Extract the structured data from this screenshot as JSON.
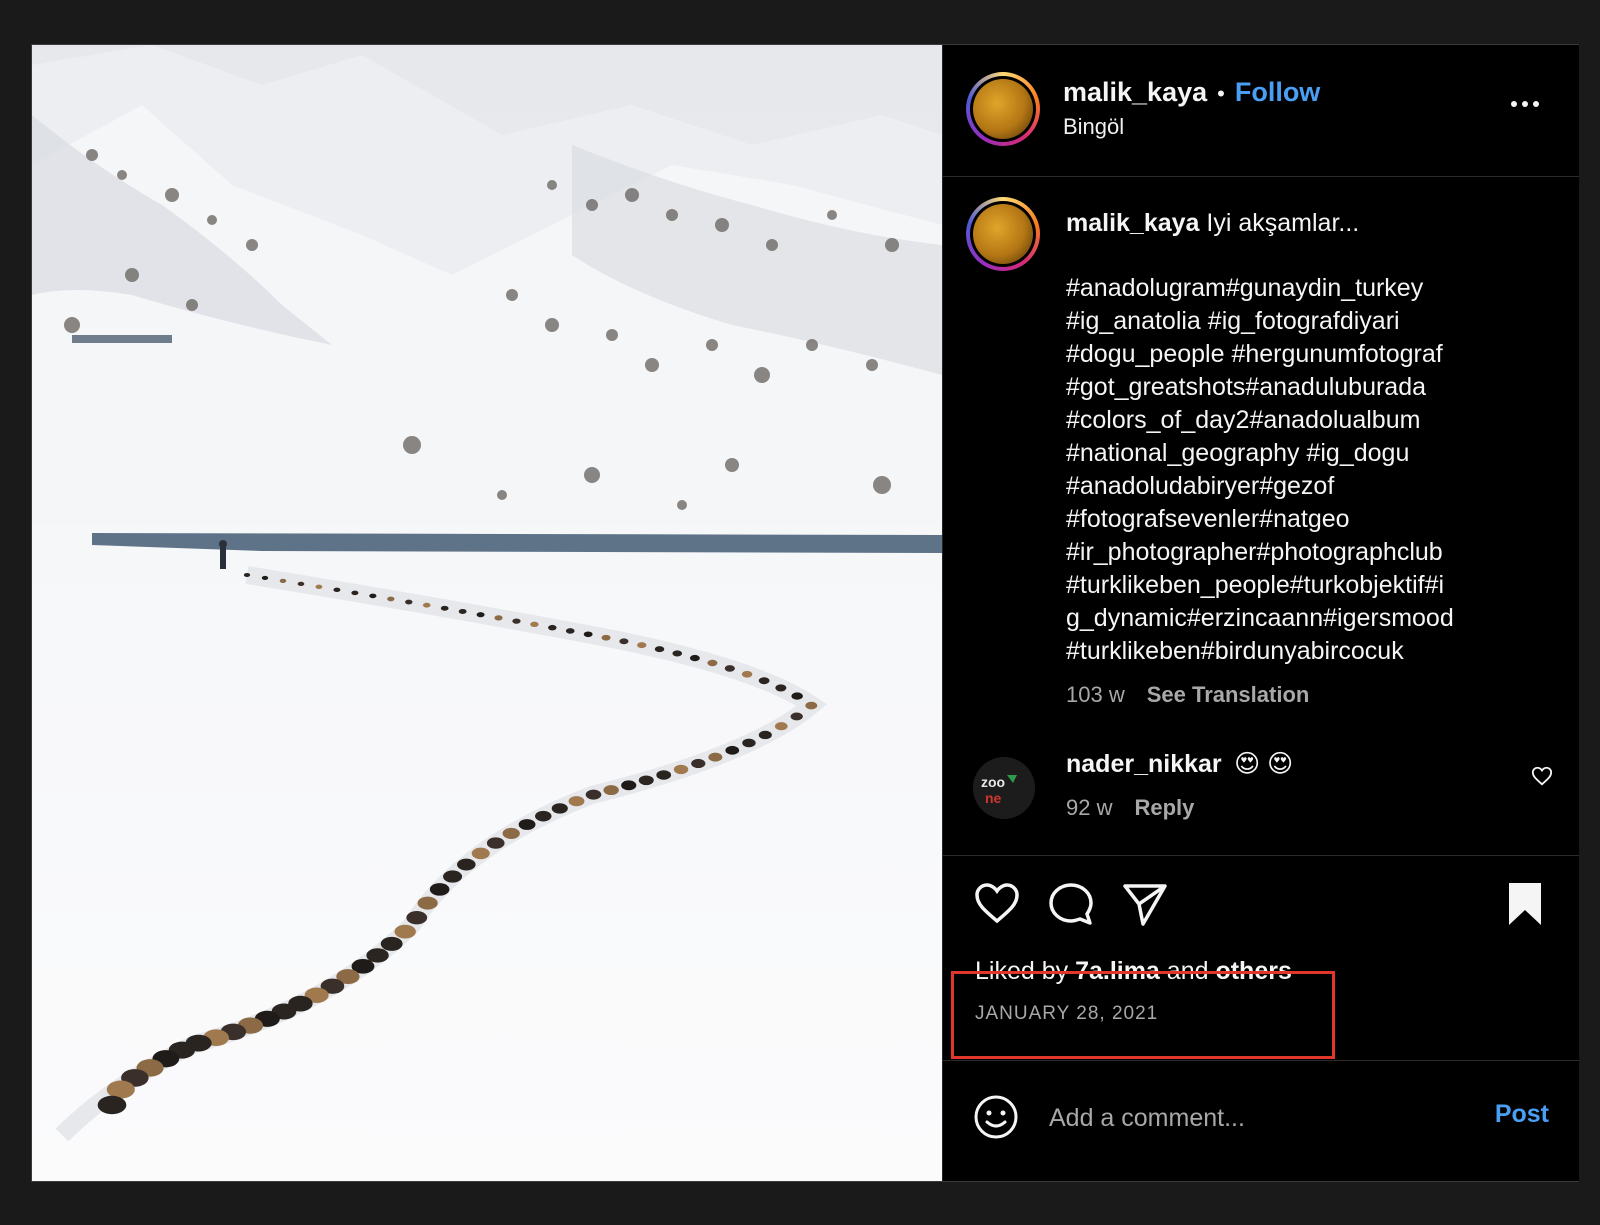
{
  "post": {
    "author": {
      "username": "malik_kaya",
      "follow_label": "Follow",
      "separator": "•",
      "location": "Bingöl"
    },
    "caption": {
      "username": "malik_kaya",
      "text": "Iyi akşamlar...",
      "hashtags": "#anadolugram#gunaydin_turkey\n#ig_anatolia #ig_fotografdiyari\n#dogu_people  #hergunumfotograf\n#got_greatshots#anaduluburada\n#colors_of_day2#anadolualbum\n#national_geography #ig_dogu\n#anadoludabiryer#gezof\n#fotografsevenler#natgeo\n#ir_photographer#photographclub\n#turklikeben_people#turkobjektif#i\ng_dynamic#erzincaann#igersmood\n#turklikeben#birdunyabircocuk",
      "age": "103 w",
      "translate_label": "See Translation"
    },
    "comments": [
      {
        "username": "nader_nikkar",
        "text": "😍 😍",
        "age": "92 w",
        "reply_label": "Reply"
      }
    ],
    "likes": {
      "prefix": "Liked by ",
      "user": "7a.lima",
      "middle": " and ",
      "others": "others"
    },
    "date": "JANUARY 28, 2021",
    "add_comment": {
      "placeholder": "Add a comment...",
      "post_label": "Post"
    },
    "icons": {
      "more": "more-options-icon",
      "like": "heart-icon",
      "comment": "comment-icon",
      "share": "send-icon",
      "save": "bookmark-icon",
      "emoji": "emoji-icon"
    },
    "colors": {
      "accent": "#4a9ff5",
      "highlight_box": "#e0362c"
    }
  }
}
